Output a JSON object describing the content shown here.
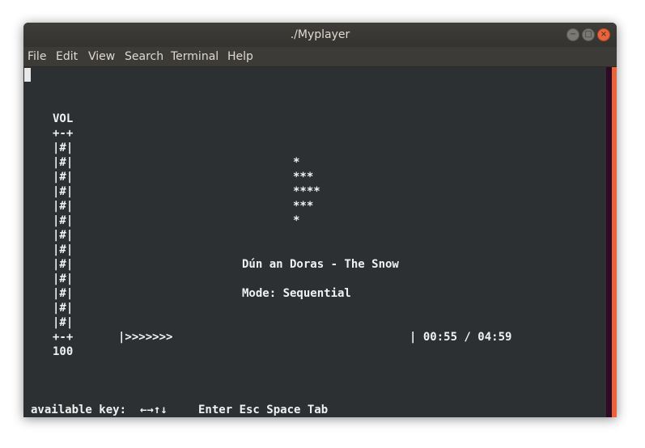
{
  "window": {
    "title": "./Myplayer",
    "buttons": {
      "minimize": "−",
      "maximize": "□",
      "close": "×"
    }
  },
  "menu": [
    "File",
    "Edit",
    "View",
    "Search",
    "Terminal",
    "Help"
  ],
  "volume": {
    "label": "VOL",
    "top": "+-+",
    "bar_rows": [
      "|#|",
      "|#|",
      "|#|",
      "|#|",
      "|#|",
      "|#|",
      "|#|",
      "|#|",
      "|#|",
      "|#|",
      "|#|",
      "|#|",
      "|#|"
    ],
    "bottom": "+-+",
    "value": "100"
  },
  "visual": [
    "*",
    "***",
    "****",
    "***",
    "*"
  ],
  "song": {
    "title": "Dún an Doras - The Snow",
    "mode": "Mode: Sequential"
  },
  "progress": {
    "bar": "|>>>>>>>",
    "time": "| 00:55 / 04:59"
  },
  "keys": {
    "label": "available key:",
    "arrows": "←→↑↓",
    "names": "Enter Esc Space Tab"
  },
  "colors": {
    "accent": "#e9633b",
    "background": "#2d3033",
    "scrollbar": "#300a24"
  }
}
